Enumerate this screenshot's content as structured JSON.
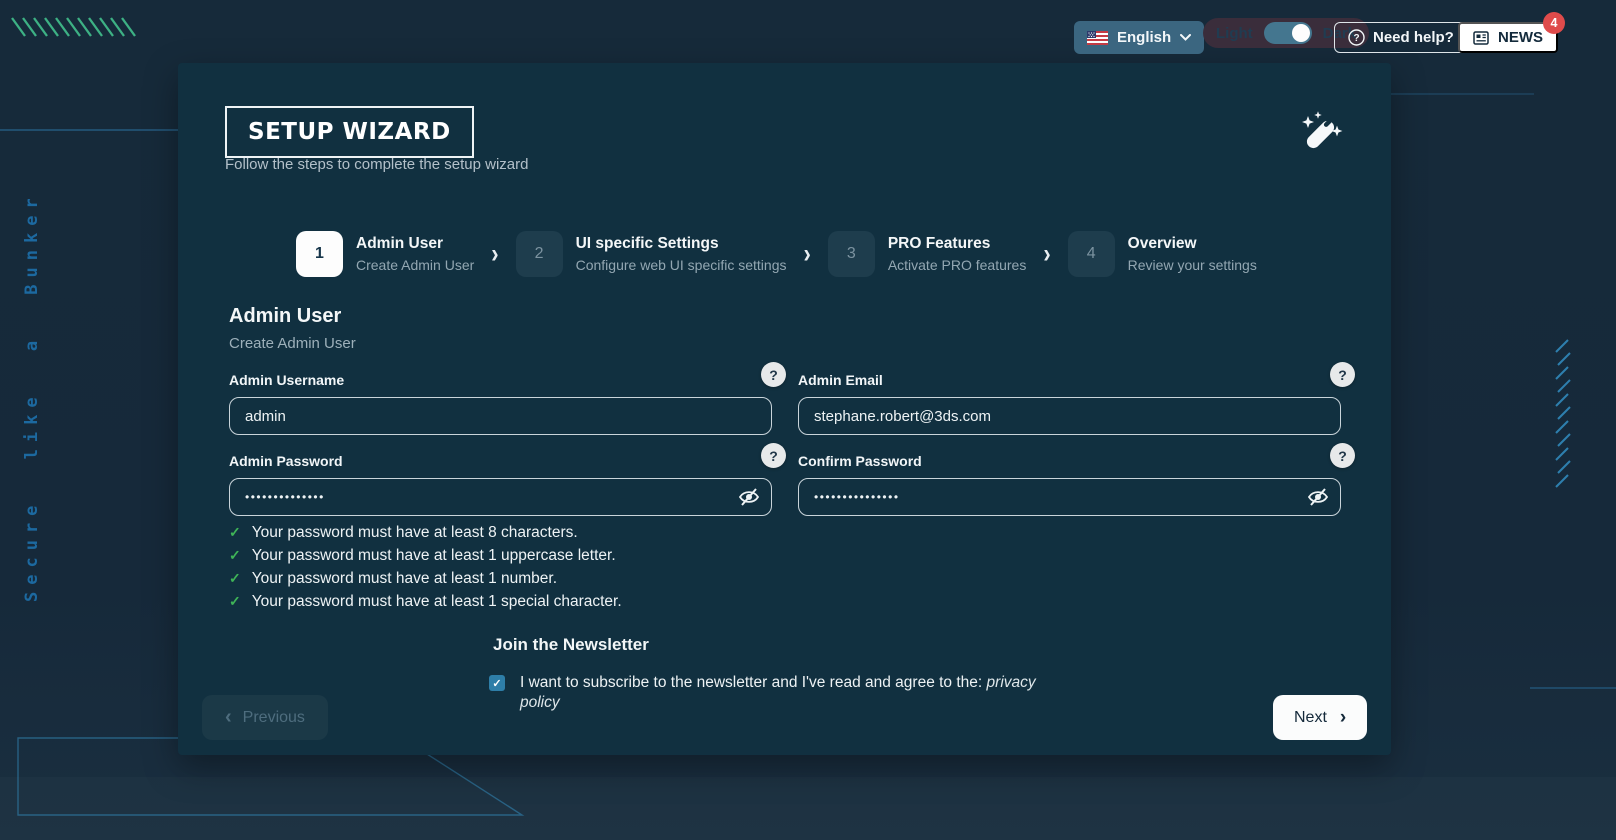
{
  "topbar": {
    "language_label": "English",
    "theme": {
      "light": "Light",
      "dark": "Dark",
      "selected": "dark"
    },
    "help_label": "Need help?",
    "news_label": "NEWS",
    "news_badge": "4"
  },
  "wizard": {
    "logo": "SETUP WIZARD",
    "tagline": "Follow the steps to complete the setup wizard",
    "steps": [
      {
        "number": "1",
        "title": "Admin User",
        "subtitle": "Create Admin User"
      },
      {
        "number": "2",
        "title": "UI specific Settings",
        "subtitle": "Configure web UI specific settings"
      },
      {
        "number": "3",
        "title": "PRO Features",
        "subtitle": "Activate PRO features"
      },
      {
        "number": "4",
        "title": "Overview",
        "subtitle": "Review your settings"
      }
    ]
  },
  "form": {
    "title": "Admin User",
    "subtitle": "Create Admin User",
    "username_label": "Admin Username",
    "username_value": "admin",
    "email_label": "Admin Email",
    "email_value": "stephane.robert@3ds.com",
    "password_label": "Admin Password",
    "password_value": "••••••••••••••",
    "confirm_label": "Confirm Password",
    "confirm_value": "•••••••••••••••",
    "rules": [
      "Your password must have at least 8 characters.",
      "Your password must have at least 1 uppercase letter.",
      "Your password must have at least 1 number.",
      "Your password must have at least 1 special character."
    ]
  },
  "newsletter": {
    "title": "Join the Newsletter",
    "consent_text": "I want to subscribe to the newsletter and I've read and agree to the:",
    "privacy_link": "privacy policy",
    "checked": true
  },
  "nav": {
    "previous": "Previous",
    "next": "Next"
  },
  "decor": {
    "vertical_text": "Secure like a Bunker"
  },
  "icons": {
    "check": "✓",
    "question": "?",
    "chevron_left": "‹",
    "chevron_right": "›",
    "step_separator": "›"
  },
  "colors": {
    "page_bg": "#16293a",
    "card_bg": "#113040",
    "accent_green": "#3db184",
    "accent_blue": "#2a76a8",
    "badge_red": "#df4b4b",
    "toggle_blue": "#44768f"
  }
}
